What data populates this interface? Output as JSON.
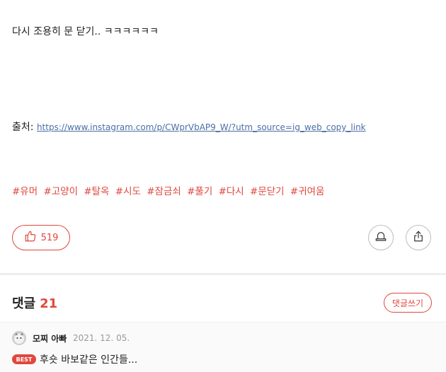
{
  "post": {
    "text": "다시 조용히 문 닫기.. ㅋㅋㅋㅋㅋㅋ",
    "source_label": "출처: ",
    "source_link": "https://www.instagram.com/p/CWprVbAP9_W/?utm_source=ig_web_copy_link",
    "tags": [
      "#유머",
      "#고양이",
      "#탈옥",
      "#시도",
      "#잠금쇠",
      "#풀기",
      "#다시",
      "#문닫기",
      "#귀여움"
    ]
  },
  "actions": {
    "like_count": "519",
    "like_icon": "thumbs-up-icon",
    "notify_icon": "bell-icon",
    "share_icon": "share-icon"
  },
  "comments": {
    "title": "댓글",
    "count": "21",
    "write_label": "댓글쓰기",
    "items": [
      {
        "author": "모찌 아빠",
        "date": "2021. 12. 05.",
        "badge": "BEST",
        "text": "후숏 바보같은 인간들..."
      }
    ]
  },
  "colors": {
    "accent": "#e0473d",
    "link": "#4a6fa5",
    "muted": "#999999"
  }
}
